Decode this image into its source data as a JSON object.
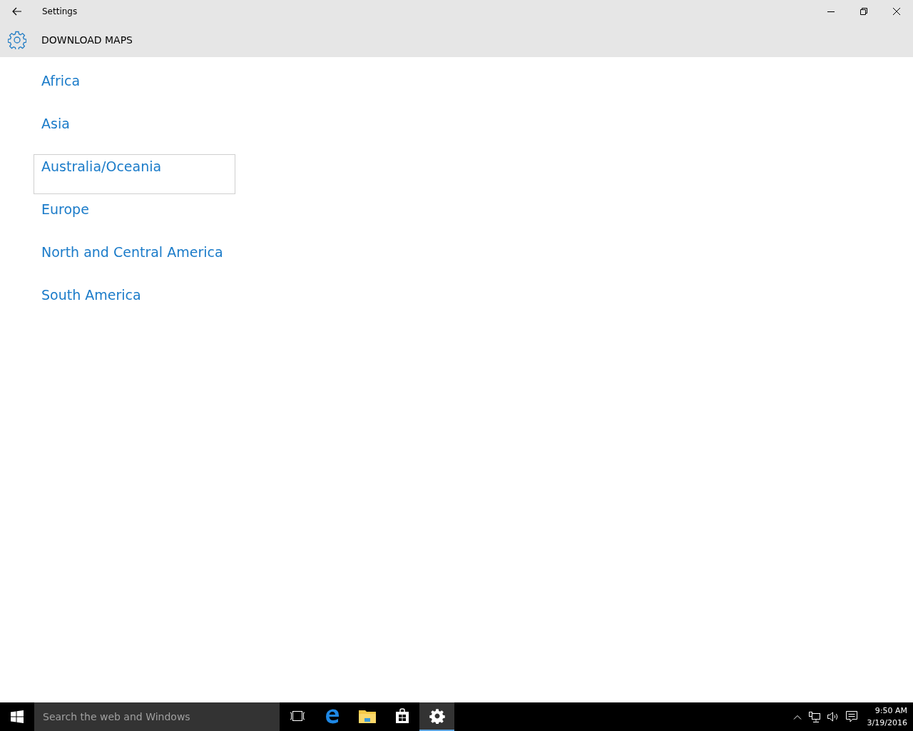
{
  "window": {
    "title": "Settings"
  },
  "header": {
    "title": "DOWNLOAD MAPS"
  },
  "regions": [
    {
      "label": "Africa",
      "focused": false
    },
    {
      "label": "Asia",
      "focused": false
    },
    {
      "label": "Australia/Oceania",
      "focused": true
    },
    {
      "label": "Europe",
      "focused": false
    },
    {
      "label": "North and Central America",
      "focused": false
    },
    {
      "label": "South America",
      "focused": false
    }
  ],
  "taskbar": {
    "search": {
      "placeholder": "Search the web and Windows"
    },
    "apps": [
      {
        "kind": "taskview",
        "active": false
      },
      {
        "kind": "browser",
        "active": false
      },
      {
        "kind": "folder",
        "active": false
      },
      {
        "kind": "store",
        "active": false
      },
      {
        "kind": "settings",
        "active": true
      }
    ],
    "time": "9:50 AM",
    "date": "3/19/2016"
  }
}
